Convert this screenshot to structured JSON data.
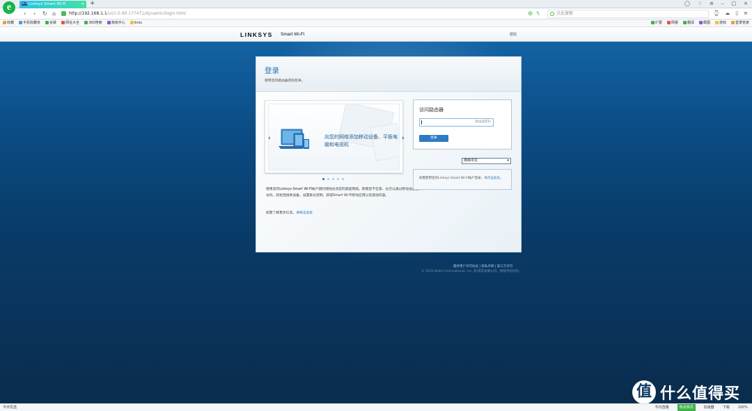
{
  "browser": {
    "tab_title": "Linksys Smart Wi-Fi",
    "tab_favicon": "Wi-Fi",
    "new_tab": "+",
    "url_host": "http://192.168.1.1",
    "url_path": "/ui/1.0.99.177471/dynamic/login.html",
    "search_placeholder": "点此搜索",
    "bookmarks": [
      "收藏",
      "手机收藏夹",
      "谷歌",
      "网址大全",
      "360搜索",
      "游戏中心",
      "links"
    ],
    "bookmarks_right": [
      "扩展",
      "网银",
      "翻译",
      "截图",
      "游戏",
      "登录管家"
    ]
  },
  "page": {
    "brand": "LINKSYS",
    "brand_sub": "Smart Wi-Fi",
    "help": "帮助",
    "title": "登录",
    "subtitle": "使用您的路由器密码登录。",
    "slide_text": "向您的网络添加移动设备、平板电脑和电视机",
    "description_prefix": "使用您的",
    "description_hl": "Linksys Smart Wi-Fi",
    "description_rest": "帐户随时随地访问您的家庭网络。即使您不在家，也可以通过移动设备上网访问。轻松连接新设备，设置家长控制，获得Smart Wi-Fi移动应用以及其他内容。",
    "more_prefix": "如需了解更多信息，",
    "more_link": "请单击此处",
    "login_box_title": "访问路由器",
    "password_placeholder": "路由器密码",
    "login_button": "登录",
    "language": "简体中文",
    "app_text": "如需使用您的Linksys Smart Wi-Fi帐户登录，",
    "app_link": "请点击此处。",
    "footer_links": "最终用户许可协议 | 隐私声明 | 第三方许可",
    "footer_copy": "© 2016 Belkin International, Inc. 及/或其关联公司。保留所有权利。"
  },
  "watermark": {
    "circle_char": "值",
    "text": "什么值得买"
  },
  "statusbar": {
    "left": "今日优选",
    "items": [
      "今日直播",
      "热点资讯",
      "加速器",
      "下载",
      "100%"
    ]
  }
}
